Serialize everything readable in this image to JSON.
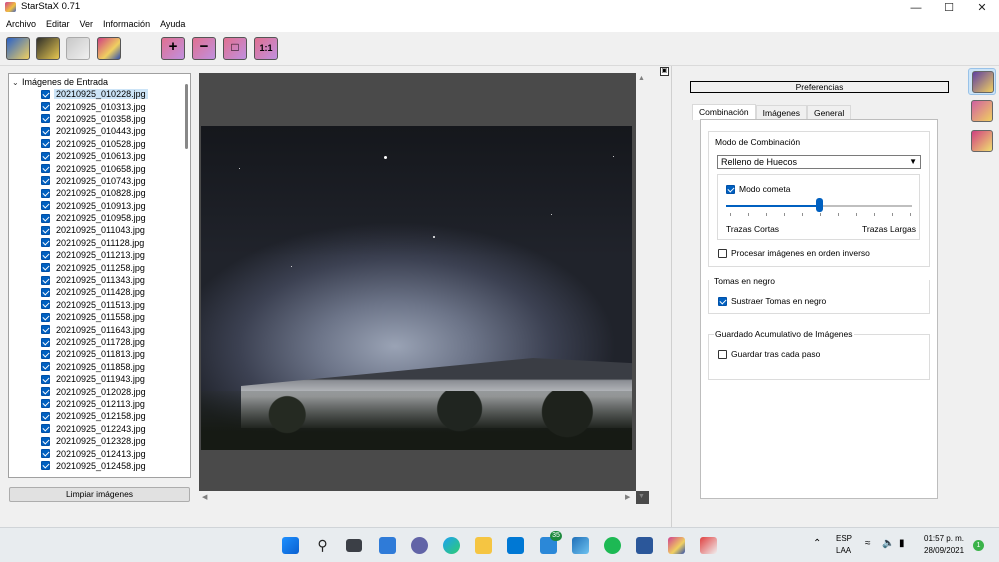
{
  "window": {
    "title": "StarStaX 0.71",
    "minimize_icon": "minimize-icon",
    "maximize_icon": "maximize-icon",
    "close_icon": "close-icon"
  },
  "menu": [
    "Archivo",
    "Editar",
    "Ver",
    "Información",
    "Ayuda"
  ],
  "toolbar": {
    "buttons": [
      "open-images-icon",
      "open-darks-icon",
      "save-icon",
      "start-processing-icon",
      "zoom-in-icon",
      "zoom-out-icon",
      "zoom-fit-icon",
      "zoom-100-icon"
    ],
    "zoom_100_label": "1:1"
  },
  "input_panel": {
    "root_label": "Imágenes de Entrada",
    "files": [
      "20210925_010228.jpg",
      "20210925_010313.jpg",
      "20210925_010358.jpg",
      "20210925_010443.jpg",
      "20210925_010528.jpg",
      "20210925_010613.jpg",
      "20210925_010658.jpg",
      "20210925_010743.jpg",
      "20210925_010828.jpg",
      "20210925_010913.jpg",
      "20210925_010958.jpg",
      "20210925_011043.jpg",
      "20210925_011128.jpg",
      "20210925_011213.jpg",
      "20210925_011258.jpg",
      "20210925_011343.jpg",
      "20210925_011428.jpg",
      "20210925_011513.jpg",
      "20210925_011558.jpg",
      "20210925_011643.jpg",
      "20210925_011728.jpg",
      "20210925_011813.jpg",
      "20210925_011858.jpg",
      "20210925_011943.jpg",
      "20210925_012028.jpg",
      "20210925_012113.jpg",
      "20210925_012158.jpg",
      "20210925_012243.jpg",
      "20210925_012328.jpg",
      "20210925_012413.jpg",
      "20210925_012458.jpg"
    ],
    "selected_index": 0,
    "clear_button": "Limpiar imágenes"
  },
  "preferences": {
    "header": "Preferencias",
    "tabs": [
      "Combinación",
      "Imágenes",
      "General"
    ],
    "active_tab": "Combinación",
    "blend_group": {
      "title": "Modo de Combinación",
      "mode_value": "Relleno de Huecos",
      "comet_label": "Modo cometa",
      "comet_checked": true,
      "slider_value": 0.5,
      "slider_min_label": "Trazas Cortas",
      "slider_max_label": "Trazas Largas",
      "reverse_label": "Procesar imágenes en orden inverso",
      "reverse_checked": false
    },
    "darks_group": {
      "title": "Tomas en negro",
      "subtract_label": "Sustraer Tomas en negro",
      "subtract_checked": true
    },
    "save_group": {
      "title": "Guardado Acumulativo de Imágenes",
      "save_each_label": "Guardar tras cada paso",
      "save_each_checked": false
    }
  },
  "side_toolbar": [
    "preferences-icon",
    "stars-icon",
    "comet-icon"
  ],
  "taskbar": {
    "apps": [
      "windows-start-icon",
      "search-icon",
      "task-view-icon",
      "widgets-icon",
      "teams-chat-icon",
      "edge-icon",
      "file-explorer-icon",
      "vscode-icon",
      "store-icon",
      "photos-icon",
      "spotify-icon",
      "word-icon",
      "starstax-icon",
      "snipping-tool-icon"
    ],
    "badge": "35",
    "lang": "ESP",
    "region": "LAA",
    "time": "01:57 p. m.",
    "date": "28/09/2021",
    "notification_count": "1"
  },
  "colors": {
    "accent": "#0060c0",
    "selection": "#cce4f7"
  }
}
